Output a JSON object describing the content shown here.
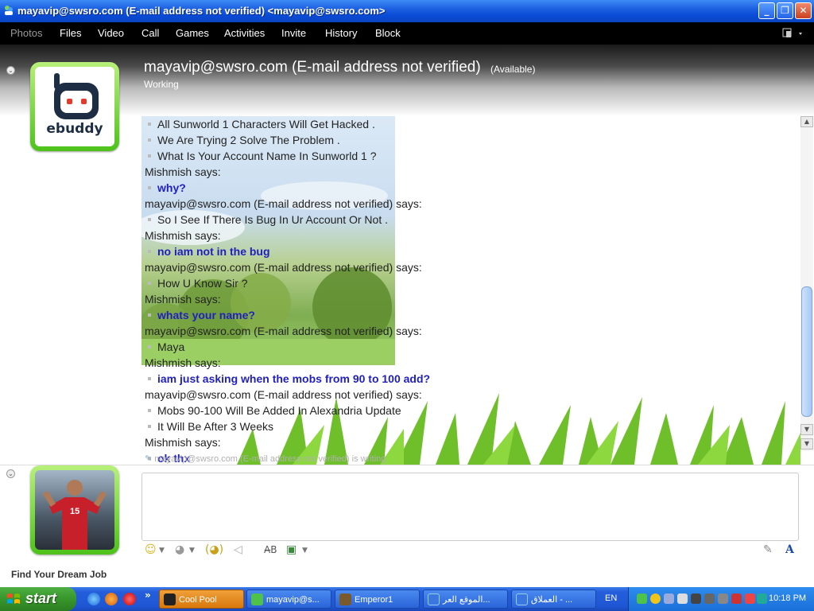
{
  "window": {
    "title": "mayavip@swsro.com (E-mail address not verified) <mayavip@swsro.com>",
    "minimize_glyph": "_",
    "maximize_glyph": "❐",
    "close_glyph": "✕"
  },
  "menu": {
    "items": [
      "Photos",
      "Files",
      "Video",
      "Call",
      "Games",
      "Activities",
      "Invite",
      "History",
      "Block"
    ]
  },
  "contact": {
    "name": "mayavip@swsro.com (E-mail address not verified)",
    "status": "(Available)",
    "personal_message": "Working",
    "logo_text": "ebuddy"
  },
  "conversation": [
    {
      "kind": "mine",
      "text": "All Sunworld 1 Characters Will Get Hacked ."
    },
    {
      "kind": "mine",
      "text": "We Are Trying 2 Solve The Problem ."
    },
    {
      "kind": "mine",
      "text": "What Is Your Account Name In Sunworld 1 ?"
    },
    {
      "kind": "sender",
      "text": "Mishmish says:"
    },
    {
      "kind": "their",
      "text": "why?"
    },
    {
      "kind": "sender",
      "text": "mayavip@swsro.com (E-mail address not verified) says:"
    },
    {
      "kind": "mine",
      "text": "So I See If There Is Bug In Ur Account Or Not ."
    },
    {
      "kind": "sender",
      "text": "Mishmish says:"
    },
    {
      "kind": "their",
      "text": "no iam not in the bug"
    },
    {
      "kind": "sender",
      "text": "mayavip@swsro.com (E-mail address not verified) says:"
    },
    {
      "kind": "mine",
      "text": "How U Know Sir ?"
    },
    {
      "kind": "sender",
      "text": "Mishmish says:"
    },
    {
      "kind": "their",
      "text": "whats your name?"
    },
    {
      "kind": "sender",
      "text": "mayavip@swsro.com (E-mail address not verified) says:"
    },
    {
      "kind": "mine",
      "text": "Maya"
    },
    {
      "kind": "sender",
      "text": "Mishmish says:"
    },
    {
      "kind": "their",
      "text": "iam just asking when the mobs from 90 to 100  add?"
    },
    {
      "kind": "sender",
      "text": "mayavip@swsro.com (E-mail address not verified) says:"
    },
    {
      "kind": "mine",
      "text": "Mobs 90-100 Will Be Added In Alexandria Update"
    },
    {
      "kind": "mine",
      "text": "It Will Be After 3 Weeks"
    },
    {
      "kind": "sender",
      "text": "Mishmish says:"
    },
    {
      "kind": "their",
      "text": "ok thx"
    }
  ],
  "typing_indicator": "mayavip@swsro.com (E-mail address not verified) is writing",
  "input": {
    "value": "",
    "placeholder": ""
  },
  "toolbar": {
    "emoticon": "☺",
    "wink": "◕",
    "nudge": "(◕)",
    "voice_clip": "◁",
    "font_label": "A̶B",
    "background": "▣",
    "pen": "✎",
    "text_style": "A"
  },
  "ad_text": "Find Your Dream Job",
  "player_number": "15",
  "taskbar": {
    "start_label": "start",
    "chevron": "»",
    "tasks": [
      {
        "label": "Cool Pool",
        "active": true,
        "color": "#222222"
      },
      {
        "label": "mayavip@s...",
        "active": false,
        "color": "#4ec24a"
      },
      {
        "label": "Emperor1",
        "active": false,
        "color": "#7a5a2a"
      },
      {
        "label": "الموقع العر...",
        "active": false,
        "color": "#3a78e0"
      },
      {
        "label": "العملاق - ...",
        "active": false,
        "color": "#3a78e0"
      }
    ],
    "language": "EN",
    "clock": "10:18 PM"
  },
  "colors": {
    "their_text": "#1f1fc0",
    "green_frame": "#4dc21a",
    "xp_blue": "#245edb",
    "start_green": "#37962b"
  }
}
